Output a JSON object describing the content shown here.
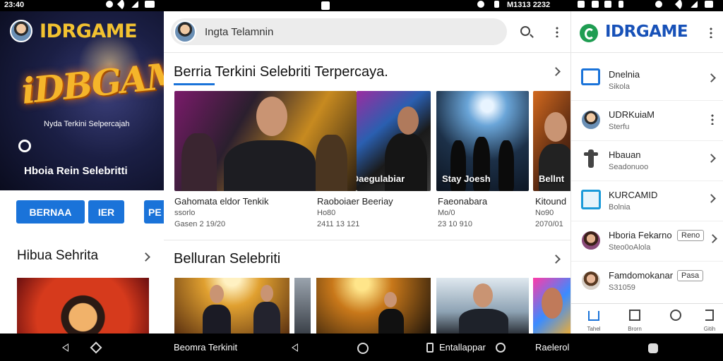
{
  "status": {
    "time_left": "23:40",
    "time_right": "M1313 2232"
  },
  "panel1": {
    "brand": "IDRGAME",
    "hero_logo": "iDBGAME",
    "hero_tagline": "Nyda Terkini Selpercajah",
    "hero_caption": "Hboia Rein Selebritti",
    "pills": [
      "BERNAA",
      "IER",
      "PE"
    ],
    "section_title": "Hibua Sehrita"
  },
  "panel2": {
    "search_placeholder": "Ingta Telamnin",
    "section1_title": "Berria Terkini Selebriti Terpercaya.",
    "cards": [
      {
        "overlay": "",
        "title": "Gahomata eldor Tenkik",
        "subtitle": "ssorlo",
        "meta": "Gasen 2 19/20"
      },
      {
        "overlay": "Bolse Oaegulabiar",
        "title": "Raoboiaer Beeriay",
        "subtitle": "Ho80",
        "meta": "2411 13 121"
      },
      {
        "overlay": "Stay Joesh",
        "title": "Faeonabara",
        "subtitle": "Mo/0",
        "meta": "23 10 910"
      },
      {
        "overlay": "Bellnt",
        "title": "Kitound",
        "subtitle": "No90",
        "meta": "2070/01"
      }
    ],
    "section2_title": "Belluran Selebriti"
  },
  "panel3": {
    "brand": "IDRGAME",
    "items": [
      {
        "icon": "tablet-icon",
        "title": "Dnelnia",
        "sub": "Sikola",
        "badge": ""
      },
      {
        "icon": "avatar",
        "title": "UDRKuiaM",
        "sub": "Sterfu",
        "badge": ""
      },
      {
        "icon": "tool-icon",
        "title": "Hbauan",
        "sub": "Seadonuoo",
        "badge": ""
      },
      {
        "icon": "app-icon",
        "title": "KURCAMID",
        "sub": "Bolnia",
        "badge": ""
      },
      {
        "icon": "avatar",
        "title": "Hboria Fekarno",
        "sub": "Steo0oAlola",
        "badge": "Reno"
      },
      {
        "icon": "avatar",
        "title": "Famdomokanar",
        "sub": "S31059",
        "badge": "Pasa"
      }
    ],
    "bottom_nav": [
      "Tahel",
      "Brorn",
      "",
      "Gitih"
    ]
  },
  "navbar": {
    "text1": "Beomra Terkinit",
    "text2": "Entallappar",
    "text3": "Raelerol"
  },
  "colors": {
    "accent": "#1a73d9",
    "brand_gold": "#f2c230",
    "brand_blue": "#1751b8"
  }
}
